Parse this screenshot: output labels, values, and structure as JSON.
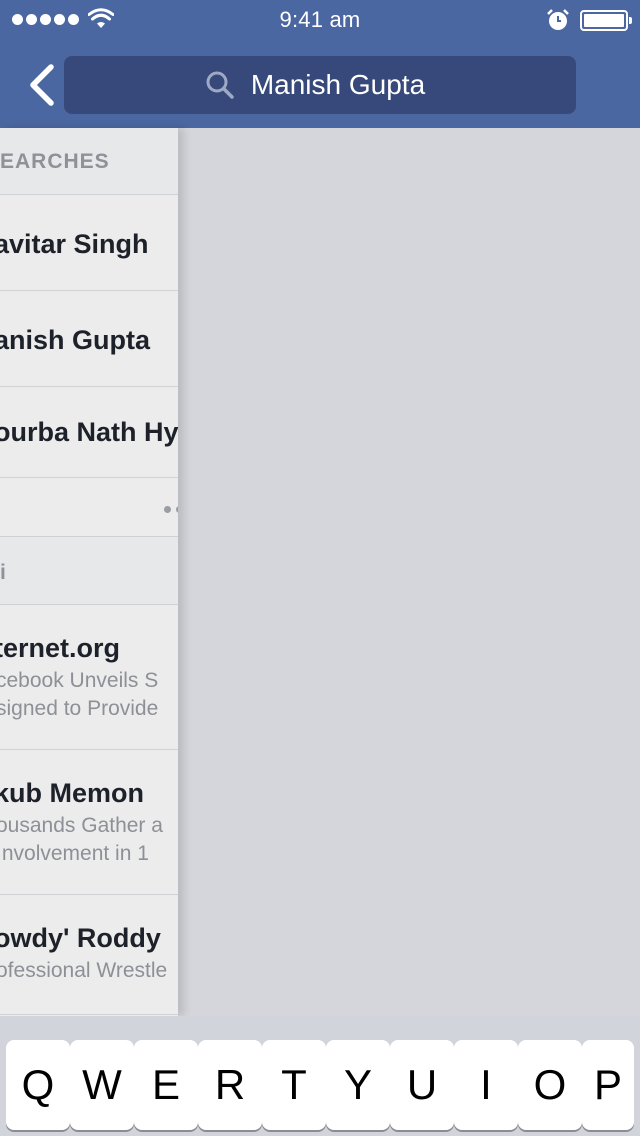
{
  "status_bar": {
    "time": "9:41 am",
    "signal_dots": 5
  },
  "nav": {
    "search_value": "Manish Gupta"
  },
  "panel": {
    "recent_header": "EARCHES",
    "recent_searches": [
      {
        "label": "avitar Singh"
      },
      {
        "label": "anish Gupta"
      },
      {
        "label": "ourba Nath Hy"
      }
    ],
    "trending_header": "i",
    "trending": [
      {
        "title": "ternet.org",
        "line1": "cebook Unveils S",
        "line2": "signed to Provide"
      },
      {
        "title": "kub Memon",
        "line1": "ousands Gather a",
        "line2": "Involvement in 1"
      },
      {
        "title": "owdy' Roddy",
        "line1": "ofessional Wrestle",
        "line2": ""
      }
    ]
  },
  "keyboard": {
    "row1": [
      "Q",
      "W",
      "E",
      "R",
      "T",
      "Y",
      "U",
      "I",
      "O",
      "P"
    ]
  },
  "colors": {
    "nav_bg": "#4b67a1",
    "search_bg": "#36497a",
    "panel_bg": "#ececec",
    "content_bg": "#d4d6db"
  }
}
